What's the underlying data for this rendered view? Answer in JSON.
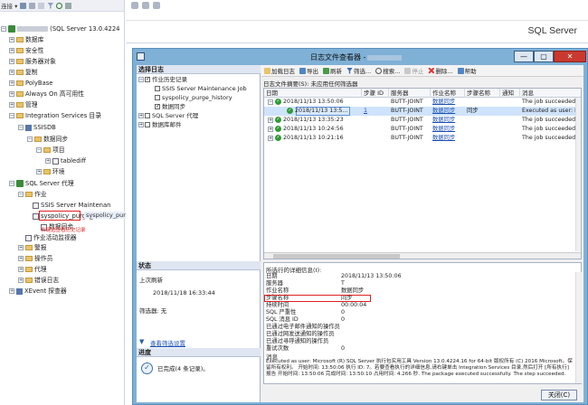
{
  "object_explorer": {
    "toolbar": {
      "connect_label": "连接 ▾"
    },
    "server_suffix": "(SQL Server 13.0.4224",
    "nodes": {
      "databases": "数据库",
      "security": "安全性",
      "server_objects": "服务器对象",
      "replication": "复制",
      "polybase": "PolyBase",
      "always_on": "Always On 高可用性",
      "management": "管理",
      "is_catalog": "Integration Services 目录",
      "ssisdb": "SSISDB",
      "data_sync": "数据同步",
      "project": "项目",
      "tablediff": "tablediff",
      "environment": "环境",
      "agent": "SQL Server 代理",
      "jobs": "作业",
      "job_ssis": "SSIS Server Maintenan",
      "job_purge": "syspolicy_purge_histo",
      "job_sync": "数据同步",
      "job_sibling": "syspolicy_purg",
      "job_activity": "作业活动监视器",
      "alerts": "警报",
      "operators": "操作员",
      "proxies": "代理",
      "error_logs": "错误日志",
      "xevent": "XEvent 探查器"
    },
    "annotation": "右键选查看历史记录"
  },
  "document": {
    "title": "SQL Server"
  },
  "dialog": {
    "title": "日志文件查看器 -",
    "window_buttons": {
      "minimize": "—",
      "maximize": "▢",
      "close": "✕"
    },
    "left_pane": {
      "select_logs_header": "选择日志",
      "tree": {
        "job_history": "作业历史记录",
        "ssis_maintenance": "SSIS Server Maintenance Job",
        "syspolicy_purge": "syspolicy_purge_history",
        "data_sync": "数据同步",
        "sql_agent": "SQL Server 代理",
        "db_mail": "数据库邮件"
      },
      "status_header": "状态",
      "last_refresh_label": "上次刷新",
      "last_refresh_value": "2018/11/18 16:33:44",
      "filter_label": "筛选器: 无",
      "view_filter_link": "查看筛选设置",
      "progress_header": "进度",
      "progress_value": "已完成(4 条记录)。"
    },
    "toolbar": {
      "load_log": "加载日志",
      "export": "导出",
      "refresh": "刷新",
      "filter": "筛选...",
      "search": "搜索...",
      "stop": "停止",
      "delete": "删除...",
      "help": "帮助"
    },
    "summary": "日志文件摘要(S): 未应用任何筛选器",
    "grid": {
      "columns": [
        "日期",
        "步骤 ID",
        "服务器",
        "作业名称",
        "步骤名称",
        "通知",
        "消息"
      ],
      "rows": [
        {
          "expander": "−",
          "date": "2018/11/13 13:50:06",
          "step_id": "",
          "server": "BUTT-JOINT",
          "job": "数据同步",
          "step": "",
          "notify": "",
          "message": "The job succeeded.  Th"
        },
        {
          "expander": "",
          "date": "2018/11/13 13:5...",
          "step_id": "1",
          "server": "BUTT-JOINT",
          "job": "数据同步",
          "step": "同步",
          "notify": "",
          "message": "Executed as user: BUT"
        },
        {
          "expander": "+",
          "date": "2018/11/13 13:35:23",
          "step_id": "",
          "server": "BUTT-JOINT",
          "job": "数据同步",
          "step": "",
          "notify": "",
          "message": "The job succeeded.  Th"
        },
        {
          "expander": "+",
          "date": "2018/11/13 10:24:56",
          "step_id": "",
          "server": "BUTT-JOINT",
          "job": "数据同步",
          "step": "",
          "notify": "",
          "message": "The job succeeded.  Th"
        },
        {
          "expander": "+",
          "date": "2018/11/13 10:21:16",
          "step_id": "",
          "server": "BUTT-JOINT",
          "job": "数据同步",
          "step": "",
          "notify": "",
          "message": "The job succeeded.  Th"
        }
      ]
    },
    "details": {
      "header": "所选行的详细信息(I):",
      "fields": [
        {
          "label": "日期",
          "value": "2018/11/13 13:50:06"
        },
        {
          "label": "服务器",
          "value": "T"
        },
        {
          "label": "作业名称",
          "value": "数据同步"
        },
        {
          "label": "步骤名称",
          "value": "同步"
        },
        {
          "label": "持续时间",
          "value": "00:00:04"
        },
        {
          "label": "SQL 严重性",
          "value": "0"
        },
        {
          "label": "SQL 消息 ID",
          "value": "0"
        },
        {
          "label": "已通过电子邮件通知的操作员",
          "value": ""
        },
        {
          "label": "已通过网发送通知的操作员",
          "value": ""
        },
        {
          "label": "已通过寻呼通知的操作员",
          "value": ""
        },
        {
          "label": "重试次数",
          "value": "0"
        }
      ],
      "message_label": "消息",
      "message_text": "Executed as user:                    Microsoft (R) SQL Server 执行包实用工具  Version 13.0.4224.16 for 64-bit  版权所有 (C) 2016 Microsoft。保留所有权利。  开始时间:  13:50:06  执行 ID: 7。若要查看执行的详细信息,请右键单击 Integration Services 目录,然后打开 [所有执行] 报告  开始时间:  13:50:06  完成时间: 13:50:10  占用时间: 4.266 秒.  The package executed successfully.  The step succeeded."
    },
    "close_button": "关闭(C)"
  }
}
